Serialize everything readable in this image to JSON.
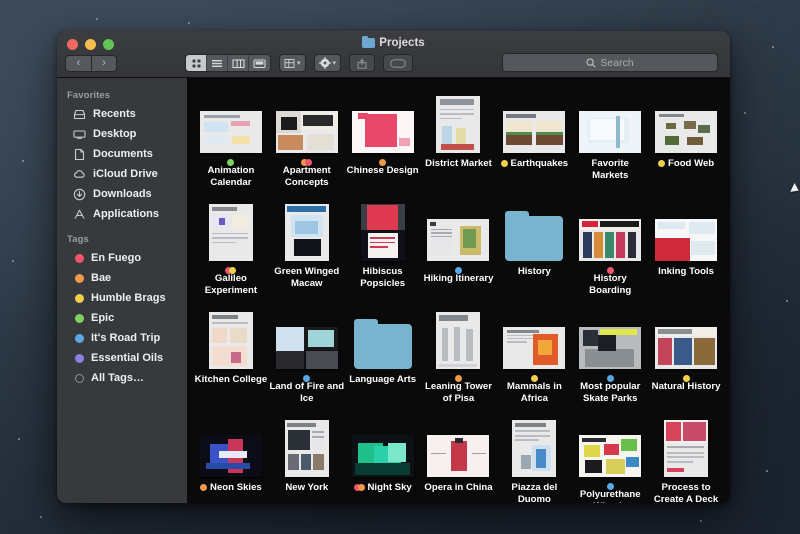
{
  "window": {
    "title": "Projects",
    "title_icon": "folder-icon",
    "traffic_lights": [
      {
        "name": "close",
        "color": "#ee6a5e"
      },
      {
        "name": "minimize",
        "color": "#f4be4f"
      },
      {
        "name": "maximize",
        "color": "#61c454"
      }
    ]
  },
  "toolbar": {
    "back_label": "‹",
    "forward_label": "›",
    "view_modes": [
      {
        "name": "icon-view",
        "icon": "grid-icon",
        "active": true
      },
      {
        "name": "list-view",
        "icon": "list-icon",
        "active": false
      },
      {
        "name": "column-view",
        "icon": "columns-icon",
        "active": false
      },
      {
        "name": "gallery-view",
        "icon": "gallery-icon",
        "active": false
      }
    ],
    "group_by": {
      "name": "group-by-button",
      "icon": "group-icon",
      "caret": "▾"
    },
    "action": {
      "name": "action-button",
      "icon": "gear-icon",
      "caret": "▾"
    },
    "share": {
      "name": "share-button",
      "icon": "share-icon"
    },
    "tags": {
      "name": "tags-button",
      "icon": "tag-icon"
    }
  },
  "search": {
    "icon": "search-icon",
    "placeholder": "Search",
    "value": ""
  },
  "sidebar": {
    "favorites_header": "Favorites",
    "favorites": [
      {
        "label": "Recents",
        "icon": "recents-icon"
      },
      {
        "label": "Desktop",
        "icon": "desktop-icon"
      },
      {
        "label": "Documents",
        "icon": "documents-icon"
      },
      {
        "label": "iCloud Drive",
        "icon": "icloud-icon"
      },
      {
        "label": "Downloads",
        "icon": "downloads-icon"
      },
      {
        "label": "Applications",
        "icon": "applications-icon"
      }
    ],
    "tags_header": "Tags",
    "tags": [
      {
        "label": "En Fuego",
        "color": "#f0566b"
      },
      {
        "label": "Bae",
        "color": "#f0994a"
      },
      {
        "label": "Humble Brags",
        "color": "#f0cf4a"
      },
      {
        "label": "Epic",
        "color": "#7ed463"
      },
      {
        "label": "It's Road Trip",
        "color": "#5aa9e6"
      },
      {
        "label": "Essential Oils",
        "color": "#8a82e0"
      },
      {
        "label": "All Tags…",
        "color": "outline"
      }
    ]
  },
  "files": [
    {
      "name": "Animation Calendar",
      "kind": "document",
      "shape": "land",
      "tags": [
        "#7ed463"
      ],
      "art": "animation"
    },
    {
      "name": "Apartment Concepts",
      "kind": "document",
      "shape": "land",
      "tags": [
        "#f0994a",
        "#f0566b"
      ],
      "art": "moodboard"
    },
    {
      "name": "Chinese Design",
      "kind": "document",
      "shape": "land",
      "tags": [
        "#f0994a"
      ],
      "art": "chinese"
    },
    {
      "name": "District Market",
      "kind": "document",
      "shape": "port",
      "tags": [],
      "art": "market"
    },
    {
      "name": "Earthquakes",
      "kind": "document",
      "shape": "land",
      "tags": [
        "#f0cf4a"
      ],
      "art": "quake"
    },
    {
      "name": "Favorite Markets",
      "kind": "document",
      "shape": "land",
      "tags": [],
      "art": "map"
    },
    {
      "name": "Food Web",
      "kind": "document",
      "shape": "land",
      "tags": [
        "#f0cf4a"
      ],
      "art": "foodweb"
    },
    {
      "name": "Galileo Experiment",
      "kind": "document",
      "shape": "port",
      "tags": [
        "#f0566b",
        "#f0cf4a"
      ],
      "art": "galileo"
    },
    {
      "name": "Green Winged Macaw",
      "kind": "document",
      "shape": "port",
      "tags": [],
      "art": "macaw"
    },
    {
      "name": "Hibiscus Popsicles",
      "kind": "document",
      "shape": "port",
      "tags": [],
      "art": "hibiscus"
    },
    {
      "name": "Hiking Itinerary",
      "kind": "document",
      "shape": "land",
      "tags": [
        "#5aa9e6"
      ],
      "art": "hiking"
    },
    {
      "name": "History",
      "kind": "folder",
      "shape": "folder",
      "tags": [],
      "art": ""
    },
    {
      "name": "History Boarding",
      "kind": "document",
      "shape": "land",
      "tags": [
        "#f0566b"
      ],
      "art": "boards"
    },
    {
      "name": "Inking Tools",
      "kind": "document",
      "shape": "land",
      "tags": [],
      "art": "inking"
    },
    {
      "name": "Kitchen College",
      "kind": "document",
      "shape": "port",
      "tags": [],
      "art": "kitchen"
    },
    {
      "name": "Land of Fire and Ice",
      "kind": "document",
      "shape": "land",
      "tags": [
        "#5aa9e6"
      ],
      "art": "fireice"
    },
    {
      "name": "Language Arts",
      "kind": "folder",
      "shape": "folder",
      "tags": [],
      "art": ""
    },
    {
      "name": "Leaning Tower of Pisa",
      "kind": "document",
      "shape": "port",
      "tags": [
        "#f0994a"
      ],
      "art": "pisa"
    },
    {
      "name": "Mammals in Africa",
      "kind": "document",
      "shape": "land",
      "tags": [
        "#f0cf4a"
      ],
      "art": "africa"
    },
    {
      "name": "Most popular Skate Parks",
      "kind": "document",
      "shape": "land",
      "tags": [
        "#5aa9e6"
      ],
      "art": "skate"
    },
    {
      "name": "Natural History",
      "kind": "document",
      "shape": "land",
      "tags": [
        "#f0cf4a"
      ],
      "art": "natural"
    },
    {
      "name": "Neon Skies",
      "kind": "document",
      "shape": "land",
      "tags": [
        "#f0994a"
      ],
      "art": "neon"
    },
    {
      "name": "New York",
      "kind": "document",
      "shape": "port",
      "tags": [],
      "art": "newyork"
    },
    {
      "name": "Night Sky",
      "kind": "document",
      "shape": "land",
      "tags": [
        "#f0566b",
        "#f0994a"
      ],
      "art": "nightsky"
    },
    {
      "name": "Opera in China",
      "kind": "document",
      "shape": "land",
      "tags": [],
      "art": "opera"
    },
    {
      "name": "Piazza del Duomo",
      "kind": "document",
      "shape": "port",
      "tags": [],
      "art": "piazza"
    },
    {
      "name": "Polyurethane Wheels",
      "kind": "document",
      "shape": "land",
      "tags": [
        "#5aa9e6"
      ],
      "art": "wheels"
    },
    {
      "name": "Process to Create A Deck",
      "kind": "document",
      "shape": "port",
      "tags": [],
      "art": "deck"
    }
  ]
}
